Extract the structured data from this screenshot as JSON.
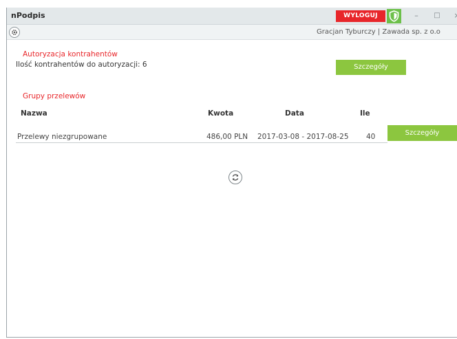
{
  "window": {
    "title": "nPodpis",
    "logout_label": "WYLOGUJ",
    "minimize_label": "–",
    "maximize_label": "□",
    "close_label": "×"
  },
  "toolbar": {
    "user_info": "Gracjan Tyburczy | Zawada sp. z o.o"
  },
  "contractors": {
    "section_title": "Autoryzacja kontrahentów",
    "count_text": "Ilość kontrahentów do autoryzacji: 6",
    "details_label": "Szczegóły"
  },
  "groups": {
    "section_title": "Grupy przelewów",
    "columns": {
      "name": "Nazwa",
      "amount": "Kwota",
      "date": "Data",
      "count": "Ile"
    },
    "rows": [
      {
        "name": "Przelewy niezgrupowane",
        "amount": "486,00 PLN",
        "date": "2017-03-08 - 2017-08-25",
        "count": "40",
        "details_label": "Szczegóły"
      }
    ]
  },
  "colors": {
    "accent_red": "#e8262a",
    "accent_green": "#8cc63f",
    "shield_green": "#6cc04a"
  },
  "icons": [
    "shield-icon",
    "gear-icon",
    "refresh-icon"
  ]
}
